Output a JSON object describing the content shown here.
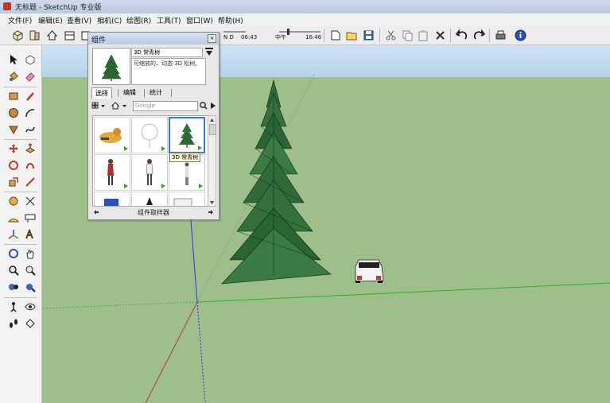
{
  "window": {
    "title": "无标题 - SketchUp 专业版"
  },
  "menubar": {
    "items": [
      "文件(F)",
      "编辑(E)",
      "查看(V)",
      "相机(C)",
      "绘图(R)",
      "工具(T)",
      "窗口(W)",
      "帮助(H)"
    ]
  },
  "shadow": {
    "month_letters": "N D",
    "time_start": "06:43",
    "noon_label": "中午",
    "time_end": "16:46"
  },
  "components_panel": {
    "title": "组件",
    "close_glyph": "×",
    "component_name": "3D 常青树",
    "component_desc": "可缩放的、动态 3D 松树。",
    "tabs": [
      "选择",
      "编辑",
      "统计"
    ],
    "search_placeholder": "Google",
    "tooltip": "3D 常青树",
    "footer": "组件取样器"
  },
  "colors": {
    "sky": "#c3dbef",
    "ground": "#9fbf8a",
    "tree": "#2f6b3a",
    "blue_axis": "#2d2dff",
    "red_axis": "#c0392b",
    "green_axis": "#2bb52b",
    "selection": "#3b78d8"
  }
}
